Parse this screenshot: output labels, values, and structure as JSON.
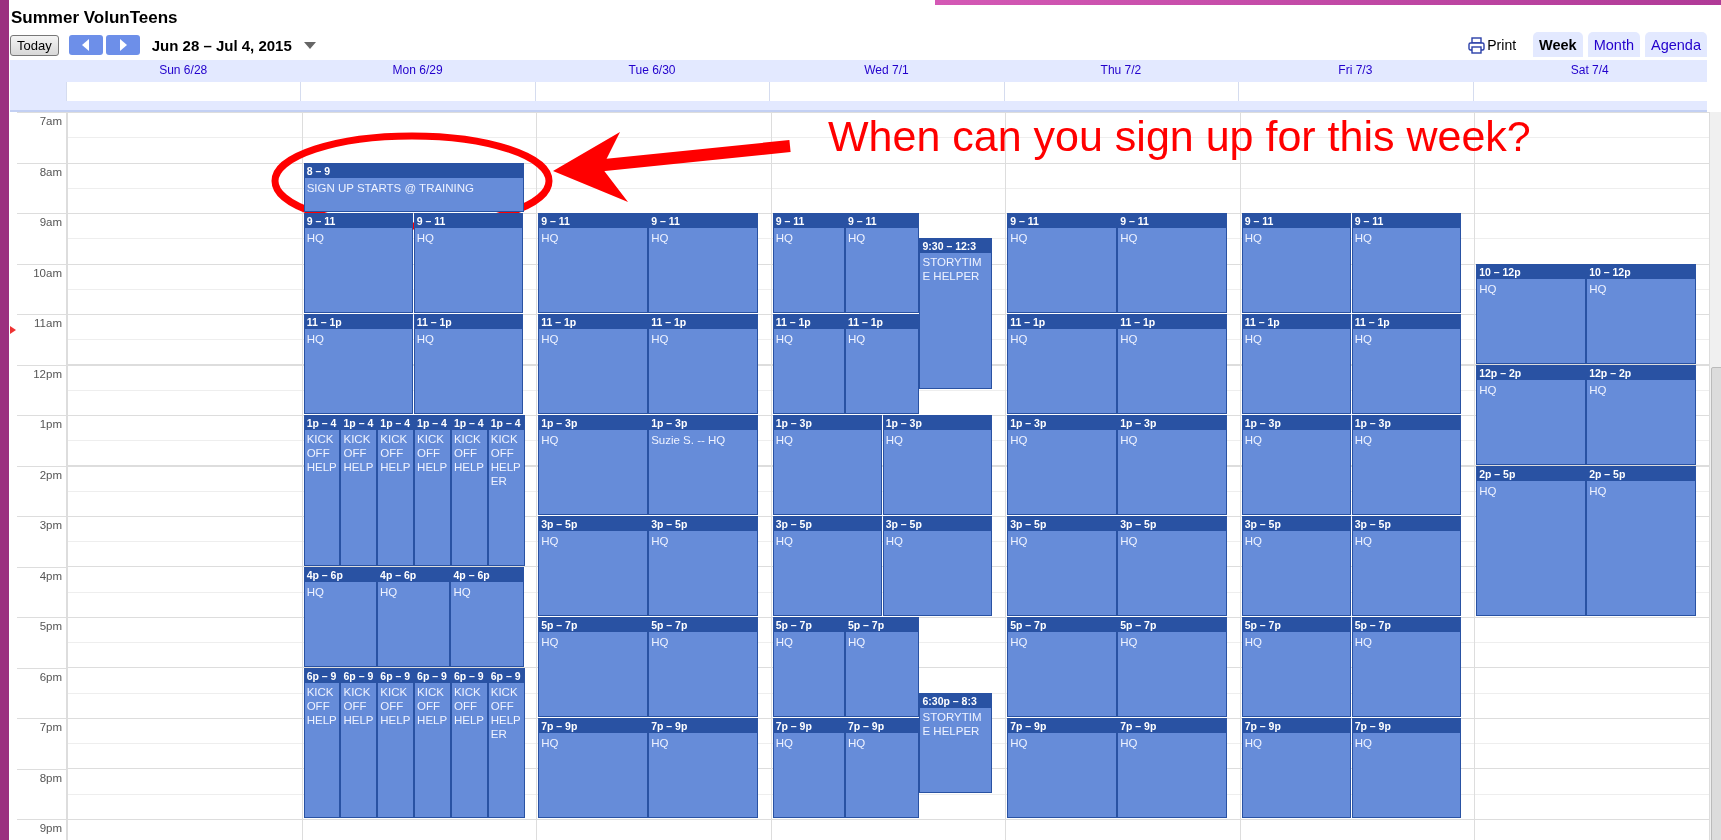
{
  "calendar_title": "Summer VolunTeens",
  "toolbar": {
    "today": "Today",
    "date_range": "Jun 28 – Jul 4, 2015",
    "print": "Print"
  },
  "view_tabs": [
    {
      "label": "Week",
      "selected": true
    },
    {
      "label": "Month",
      "selected": false
    },
    {
      "label": "Agenda",
      "selected": false
    }
  ],
  "time_labels": [
    "7am",
    "8am",
    "9am",
    "10am",
    "11am",
    "12pm",
    "1pm",
    "2pm",
    "3pm",
    "4pm",
    "5pm",
    "6pm",
    "7pm",
    "8pm",
    "9pm"
  ],
  "days": [
    {
      "label": "Sun 6/28"
    },
    {
      "label": "Mon 6/29",
      "events": [
        {
          "time": "8 – 9",
          "title": "SIGN UP STARTS @ TRAINING"
        },
        {
          "time": "9 – 11",
          "title": "HQ"
        },
        {
          "time": "9 – 11",
          "title": "HQ"
        },
        {
          "time": "11 – 1p",
          "title": "HQ"
        },
        {
          "time": "11 – 1p",
          "title": "HQ"
        },
        {
          "time": "1p – 4",
          "title": "KICK OFF HELP"
        },
        {
          "time": "1p – 4",
          "title": "KICK OFF HELP"
        },
        {
          "time": "1p – 4",
          "title": "KICK OFF HELP"
        },
        {
          "time": "1p – 4",
          "title": "KICK OFF HELP"
        },
        {
          "time": "1p – 4",
          "title": "KICK OFF HELP"
        },
        {
          "time": "1p – 4",
          "title": "KICK OFF HELPER"
        },
        {
          "time": "4p – 6p",
          "title": "HQ"
        },
        {
          "time": "4p – 6p",
          "title": "HQ"
        },
        {
          "time": "4p – 6p",
          "title": "HQ"
        },
        {
          "time": "6p – 9",
          "title": "KICK OFF HELP"
        },
        {
          "time": "6p – 9",
          "title": "KICK OFF HELP"
        },
        {
          "time": "6p – 9",
          "title": "KICK OFF HELP"
        },
        {
          "time": "6p – 9",
          "title": "KICK OFF HELP"
        },
        {
          "time": "6p – 9",
          "title": "KICK OFF HELP"
        },
        {
          "time": "6p – 9",
          "title": "KICK OFF HELPER"
        }
      ]
    },
    {
      "label": "Tue 6/30",
      "events": [
        {
          "time": "9 – 11",
          "title": "HQ"
        },
        {
          "time": "9 – 11",
          "title": "HQ"
        },
        {
          "time": "11 – 1p",
          "title": "HQ"
        },
        {
          "time": "11 – 1p",
          "title": "HQ"
        },
        {
          "time": "1p – 3p",
          "title": "HQ"
        },
        {
          "time": "1p – 3p",
          "title": "Suzie S. -- HQ"
        },
        {
          "time": "3p – 5p",
          "title": "HQ"
        },
        {
          "time": "3p – 5p",
          "title": "HQ"
        },
        {
          "time": "5p – 7p",
          "title": "HQ"
        },
        {
          "time": "5p – 7p",
          "title": "HQ"
        },
        {
          "time": "7p – 9p",
          "title": "HQ"
        },
        {
          "time": "7p – 9p",
          "title": "HQ"
        }
      ]
    },
    {
      "label": "Wed 7/1",
      "events": [
        {
          "time": "9 – 11",
          "title": "HQ"
        },
        {
          "time": "9 – 11",
          "title": "HQ"
        },
        {
          "time": "9:30 – 12:3",
          "title": "STORYTIME HELPER"
        },
        {
          "time": "11 – 1p",
          "title": "HQ"
        },
        {
          "time": "11 – 1p",
          "title": "HQ"
        },
        {
          "time": "1p – 3p",
          "title": "HQ"
        },
        {
          "time": "1p – 3p",
          "title": "HQ"
        },
        {
          "time": "3p – 5p",
          "title": "HQ"
        },
        {
          "time": "3p – 5p",
          "title": "HQ"
        },
        {
          "time": "5p – 7p",
          "title": "HQ"
        },
        {
          "time": "5p – 7p",
          "title": "HQ"
        },
        {
          "time": "6:30p – 8:3",
          "title": "STORYTIME HELPER"
        },
        {
          "time": "7p – 9p",
          "title": "HQ"
        },
        {
          "time": "7p – 9p",
          "title": "HQ"
        }
      ]
    },
    {
      "label": "Thu 7/2",
      "events": [
        {
          "time": "9 – 11",
          "title": "HQ"
        },
        {
          "time": "9 – 11",
          "title": "HQ"
        },
        {
          "time": "11 – 1p",
          "title": "HQ"
        },
        {
          "time": "11 – 1p",
          "title": "HQ"
        },
        {
          "time": "1p – 3p",
          "title": "HQ"
        },
        {
          "time": "1p – 3p",
          "title": "HQ"
        },
        {
          "time": "3p – 5p",
          "title": "HQ"
        },
        {
          "time": "3p – 5p",
          "title": "HQ"
        },
        {
          "time": "5p – 7p",
          "title": "HQ"
        },
        {
          "time": "5p – 7p",
          "title": "HQ"
        },
        {
          "time": "7p – 9p",
          "title": "HQ"
        },
        {
          "time": "7p – 9p",
          "title": "HQ"
        }
      ]
    },
    {
      "label": "Fri 7/3",
      "events": [
        {
          "time": "9 – 11",
          "title": "HQ"
        },
        {
          "time": "9 – 11",
          "title": "HQ"
        },
        {
          "time": "11 – 1p",
          "title": "HQ"
        },
        {
          "time": "11 – 1p",
          "title": "HQ"
        },
        {
          "time": "1p – 3p",
          "title": "HQ"
        },
        {
          "time": "1p – 3p",
          "title": "HQ"
        },
        {
          "time": "3p – 5p",
          "title": "HQ"
        },
        {
          "time": "3p – 5p",
          "title": "HQ"
        },
        {
          "time": "5p – 7p",
          "title": "HQ"
        },
        {
          "time": "5p – 7p",
          "title": "HQ"
        },
        {
          "time": "7p – 9p",
          "title": "HQ"
        },
        {
          "time": "7p – 9p",
          "title": "HQ"
        }
      ]
    },
    {
      "label": "Sat 7/4",
      "events": [
        {
          "time": "10 – 12p",
          "title": "HQ"
        },
        {
          "time": "10 – 12p",
          "title": "HQ"
        },
        {
          "time": "12p – 2p",
          "title": "HQ"
        },
        {
          "time": "12p – 2p",
          "title": "HQ"
        },
        {
          "time": "2p – 5p",
          "title": "HQ"
        },
        {
          "time": "2p – 5p",
          "title": "HQ"
        }
      ]
    }
  ],
  "annotation": {
    "text": "When can you sign up for this week?"
  }
}
